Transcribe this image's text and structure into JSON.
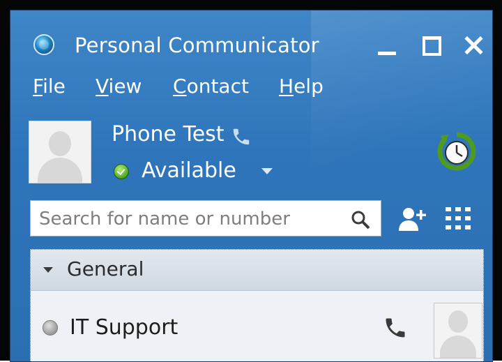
{
  "window": {
    "title": "Personal Communicator"
  },
  "menu": {
    "file": {
      "accel": "F",
      "rest": "ile"
    },
    "view": {
      "accel": "V",
      "rest": "iew"
    },
    "contact": {
      "accel": "C",
      "rest": "ontact"
    },
    "help": {
      "accel": "H",
      "rest": "elp"
    }
  },
  "user": {
    "name": "Phone Test",
    "status": "Available",
    "status_color": "#4aa822"
  },
  "search": {
    "placeholder": "Search for name or number",
    "value": ""
  },
  "groups": [
    {
      "name": "General",
      "expanded": true,
      "contacts": [
        {
          "name": "IT Support",
          "presence_color": "#9a9a9a"
        }
      ]
    }
  ],
  "icons": {
    "app": "communicator-globe-icon",
    "timer": "refresh-timer-icon",
    "add_contact": "add-contact-icon",
    "dialpad": "dialpad-icon",
    "phone": "phone-icon",
    "search": "search-icon"
  },
  "colors": {
    "window_blue": "#2f75bb",
    "panel_bg": "#eef2f6"
  }
}
